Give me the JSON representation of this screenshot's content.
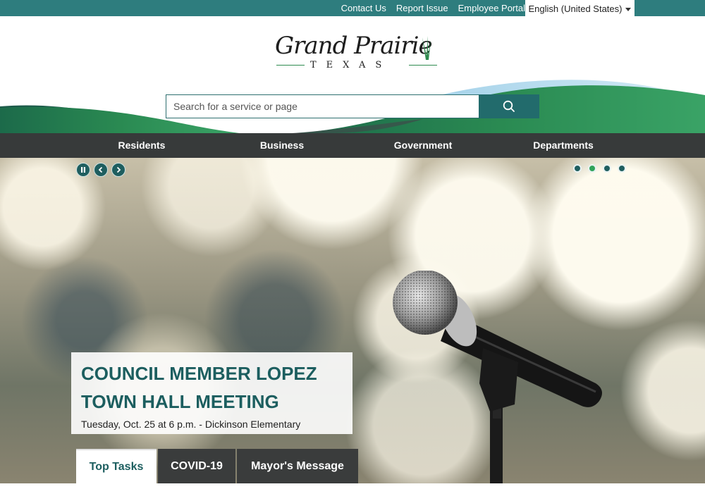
{
  "utility": {
    "links": [
      "Contact Us",
      "Report Issue",
      "Employee Portal"
    ],
    "language": "English (United States)"
  },
  "logo": {
    "name": "Grand Prairie",
    "state": "TEXAS"
  },
  "search": {
    "placeholder": "Search for a service or page",
    "icon": "search-icon"
  },
  "nav": {
    "items": [
      "Residents",
      "Business",
      "Government",
      "Departments"
    ]
  },
  "carousel": {
    "controls": [
      "pause-icon",
      "chevron-left-icon",
      "chevron-right-icon"
    ],
    "slide_count": 4,
    "active_slide": 2
  },
  "hero": {
    "title_line1": "COUNCIL MEMBER LOPEZ",
    "title_line2": "TOWN HALL MEETING",
    "subtitle": "Tuesday, Oct. 25 at 6 p.m. - Dickinson Elementary"
  },
  "tabs": {
    "items": [
      "Top Tasks",
      "COVID-19",
      "Mayor's Message"
    ],
    "active": "Top Tasks"
  },
  "colors": {
    "teal": "#2e7d7e",
    "dark_teal": "#1c5e5f",
    "green": "#2fa35a",
    "nav_bg": "#373a3a"
  }
}
